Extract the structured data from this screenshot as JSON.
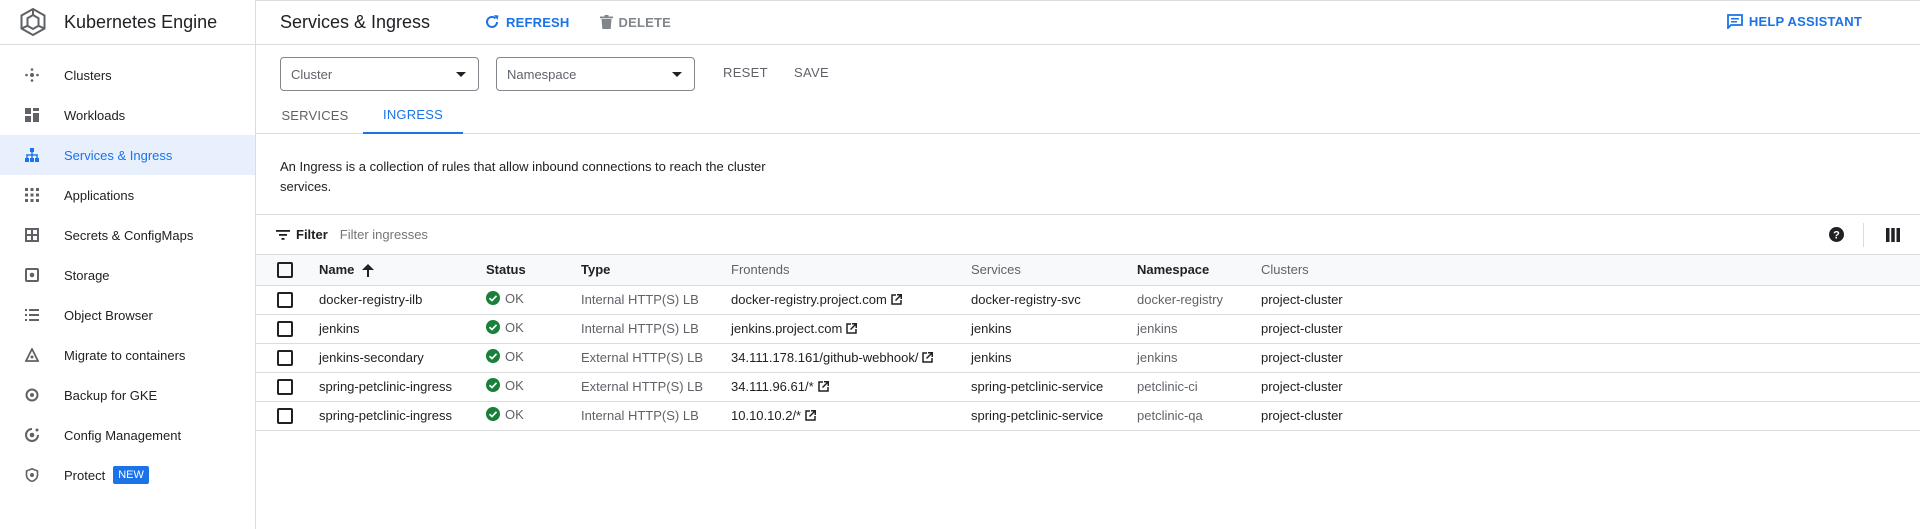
{
  "app": {
    "title": "Kubernetes Engine",
    "logo_icon": "kubernetes-engine-logo"
  },
  "sidebar": {
    "items": [
      {
        "label": "Clusters",
        "icon": "clusters-icon",
        "active": false
      },
      {
        "label": "Workloads",
        "icon": "workloads-icon",
        "active": false
      },
      {
        "label": "Services & Ingress",
        "icon": "services-icon",
        "active": true
      },
      {
        "label": "Applications",
        "icon": "applications-icon",
        "active": false
      },
      {
        "label": "Secrets & ConfigMaps",
        "icon": "secrets-icon",
        "active": false
      },
      {
        "label": "Storage",
        "icon": "storage-icon",
        "active": false
      },
      {
        "label": "Object Browser",
        "icon": "object-browser-icon",
        "active": false
      },
      {
        "label": "Migrate to containers",
        "icon": "migrate-icon",
        "active": false
      },
      {
        "label": "Backup for GKE",
        "icon": "backup-icon",
        "active": false
      },
      {
        "label": "Config Management",
        "icon": "config-management-icon",
        "active": false
      },
      {
        "label": "Protect",
        "icon": "protect-icon",
        "active": false,
        "badge": "NEW"
      }
    ]
  },
  "header": {
    "title": "Services & Ingress",
    "refresh_label": "REFRESH",
    "delete_label": "DELETE",
    "help_label": "HELP ASSISTANT"
  },
  "filters": {
    "cluster_placeholder": "Cluster",
    "namespace_placeholder": "Namespace",
    "reset_label": "RESET",
    "save_label": "SAVE"
  },
  "tabs": [
    {
      "label": "SERVICES",
      "active": false
    },
    {
      "label": "INGRESS",
      "active": true
    }
  ],
  "description": "An Ingress is a collection of rules that allow inbound connections to reach the cluster services.",
  "table_filter": {
    "label": "Filter",
    "placeholder": "Filter ingresses"
  },
  "table": {
    "columns": [
      "Name",
      "Status",
      "Type",
      "Frontends",
      "Services",
      "Namespace",
      "Clusters"
    ],
    "rows": [
      {
        "name": "docker-registry-ilb",
        "status": "OK",
        "type": "Internal HTTP(S) LB",
        "frontend": "docker-registry.project.com",
        "service": "docker-registry-svc",
        "namespace": "docker-registry",
        "cluster": "project-cluster"
      },
      {
        "name": "jenkins",
        "status": "OK",
        "type": "Internal HTTP(S) LB",
        "frontend": "jenkins.project.com",
        "service": "jenkins",
        "namespace": "jenkins",
        "cluster": "project-cluster"
      },
      {
        "name": "jenkins-secondary",
        "status": "OK",
        "type": "External HTTP(S) LB",
        "frontend": "34.111.178.161/github-webhook/",
        "service": "jenkins",
        "namespace": "jenkins",
        "cluster": "project-cluster"
      },
      {
        "name": "spring-petclinic-ingress",
        "status": "OK",
        "type": "External HTTP(S) LB",
        "frontend": "34.111.96.61/*",
        "service": "spring-petclinic-service",
        "namespace": "petclinic-ci",
        "cluster": "project-cluster"
      },
      {
        "name": "spring-petclinic-ingress",
        "status": "OK",
        "type": "Internal HTTP(S) LB",
        "frontend": "10.10.10.2/*",
        "service": "spring-petclinic-service",
        "namespace": "petclinic-qa",
        "cluster": "project-cluster"
      }
    ]
  },
  "colors": {
    "accent": "#1a73e8",
    "ok_green": "#188038",
    "active_bg": "#e8f0fe"
  }
}
